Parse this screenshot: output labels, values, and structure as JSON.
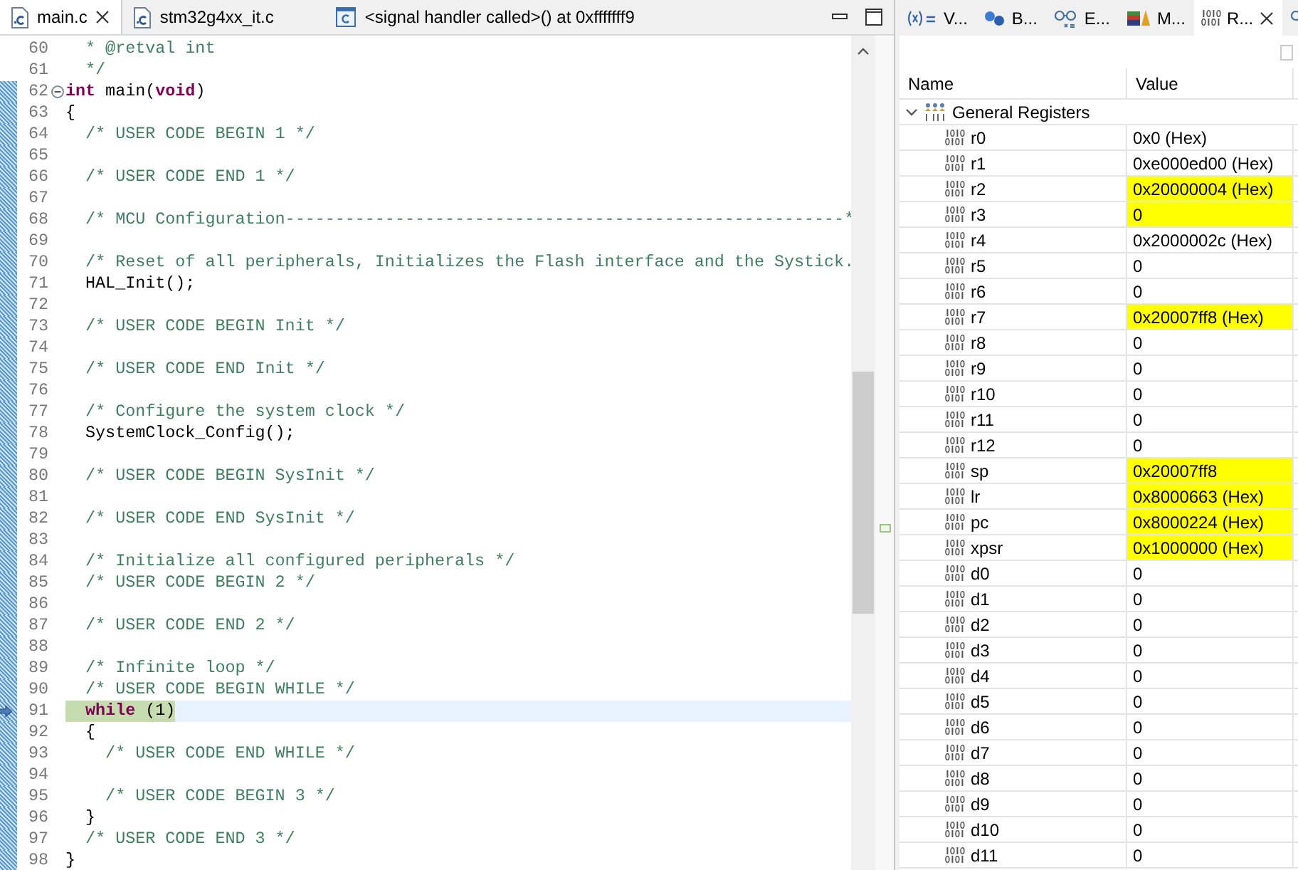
{
  "editor": {
    "tabs": [
      {
        "label": "main.c",
        "kind": "file",
        "selected": true,
        "closable": true
      },
      {
        "label": "stm32g4xx_it.c",
        "kind": "file",
        "selected": false,
        "closable": false
      },
      {
        "label": "<signal handler called>() at 0xfffffff9",
        "kind": "frame",
        "selected": false,
        "closable": false
      }
    ],
    "lines": [
      {
        "number": "60",
        "scope": false,
        "segments": [
          {
            "text": "  * @retval int",
            "kind": "comment"
          }
        ]
      },
      {
        "number": "61",
        "scope": false,
        "segments": [
          {
            "text": "  */",
            "kind": "comment"
          }
        ]
      },
      {
        "number": "62",
        "scope": true,
        "fold": true,
        "segments": [
          {
            "text": "int",
            "kind": "keyword"
          },
          {
            "text": " main(",
            "kind": "plain"
          },
          {
            "text": "void",
            "kind": "keyword"
          },
          {
            "text": ")",
            "kind": "plain"
          }
        ]
      },
      {
        "number": "63",
        "scope": true,
        "segments": [
          {
            "text": "{",
            "kind": "plain"
          }
        ]
      },
      {
        "number": "64",
        "scope": true,
        "segments": [
          {
            "text": "  /* USER CODE BEGIN 1 */",
            "kind": "comment"
          }
        ]
      },
      {
        "number": "65",
        "scope": true
      },
      {
        "number": "66",
        "scope": true,
        "segments": [
          {
            "text": "  /* USER CODE END 1 */",
            "kind": "comment"
          }
        ]
      },
      {
        "number": "67",
        "scope": true
      },
      {
        "number": "68",
        "scope": true,
        "segments": [
          {
            "text": "  /* MCU Configuration--------------------------------------------------------*",
            "kind": "comment"
          }
        ]
      },
      {
        "number": "69",
        "scope": true
      },
      {
        "number": "70",
        "scope": true,
        "segments": [
          {
            "text": "  /* Reset of all peripherals, Initializes the Flash interface and the Systick.",
            "kind": "comment"
          }
        ]
      },
      {
        "number": "71",
        "scope": true,
        "segments": [
          {
            "text": "  HAL_Init();",
            "kind": "plain"
          }
        ]
      },
      {
        "number": "72",
        "scope": true
      },
      {
        "number": "73",
        "scope": true,
        "segments": [
          {
            "text": "  /* USER CODE BEGIN Init */",
            "kind": "comment"
          }
        ]
      },
      {
        "number": "74",
        "scope": true
      },
      {
        "number": "75",
        "scope": true,
        "segments": [
          {
            "text": "  /* USER CODE END Init */",
            "kind": "comment"
          }
        ]
      },
      {
        "number": "76",
        "scope": true
      },
      {
        "number": "77",
        "scope": true,
        "segments": [
          {
            "text": "  /* Configure the system clock */",
            "kind": "comment"
          }
        ]
      },
      {
        "number": "78",
        "scope": true,
        "segments": [
          {
            "text": "  SystemClock_Config();",
            "kind": "plain"
          }
        ]
      },
      {
        "number": "79",
        "scope": true
      },
      {
        "number": "80",
        "scope": true,
        "segments": [
          {
            "text": "  /* USER CODE BEGIN SysInit */",
            "kind": "comment"
          }
        ]
      },
      {
        "number": "81",
        "scope": true
      },
      {
        "number": "82",
        "scope": true,
        "segments": [
          {
            "text": "  /* USER CODE END SysInit */",
            "kind": "comment"
          }
        ]
      },
      {
        "number": "83",
        "scope": true
      },
      {
        "number": "84",
        "scope": true,
        "segments": [
          {
            "text": "  /* Initialize all configured peripherals */",
            "kind": "comment"
          }
        ]
      },
      {
        "number": "85",
        "scope": true,
        "segments": [
          {
            "text": "  /* USER CODE BEGIN 2 */",
            "kind": "comment"
          }
        ]
      },
      {
        "number": "86",
        "scope": true
      },
      {
        "number": "87",
        "scope": true,
        "segments": [
          {
            "text": "  /* USER CODE END 2 */",
            "kind": "comment"
          }
        ]
      },
      {
        "number": "88",
        "scope": true
      },
      {
        "number": "89",
        "scope": true,
        "segments": [
          {
            "text": "  /* Infinite loop */",
            "kind": "comment"
          }
        ]
      },
      {
        "number": "90",
        "scope": true,
        "segments": [
          {
            "text": "  /* USER CODE BEGIN WHILE */",
            "kind": "comment"
          }
        ]
      },
      {
        "number": "91",
        "scope": true,
        "current": true,
        "segments": [
          {
            "text": "  while",
            "kind": "keyword"
          },
          {
            "text": " (1)",
            "kind": "plain"
          }
        ]
      },
      {
        "number": "92",
        "scope": true,
        "segments": [
          {
            "text": "  {",
            "kind": "plain"
          }
        ]
      },
      {
        "number": "93",
        "scope": true,
        "segments": [
          {
            "text": "    /* USER CODE END WHILE */",
            "kind": "comment"
          }
        ]
      },
      {
        "number": "94",
        "scope": true
      },
      {
        "number": "95",
        "scope": true,
        "segments": [
          {
            "text": "    /* USER CODE BEGIN 3 */",
            "kind": "comment"
          }
        ]
      },
      {
        "number": "96",
        "scope": true,
        "segments": [
          {
            "text": "  }",
            "kind": "plain"
          }
        ]
      },
      {
        "number": "97",
        "scope": true,
        "segments": [
          {
            "text": "  /* USER CODE END 3 */",
            "kind": "comment"
          }
        ]
      },
      {
        "number": "98",
        "scope": true,
        "segments": [
          {
            "text": "}",
            "kind": "plain"
          }
        ]
      }
    ]
  },
  "registers_view": {
    "tabs": [
      {
        "label": "V...",
        "kind": "variables",
        "selected": false
      },
      {
        "label": "B...",
        "kind": "breakpoints",
        "selected": false
      },
      {
        "label": "E...",
        "kind": "expressions",
        "selected": false
      },
      {
        "label": "M...",
        "kind": "modules",
        "selected": false
      },
      {
        "label": "R...",
        "kind": "registers",
        "selected": true
      },
      {
        "kind": "expressions",
        "selected": false
      }
    ],
    "columns": [
      "Name",
      "Value"
    ],
    "group": {
      "label": "General Registers",
      "expanded": true,
      "children": [
        {
          "name": "r0",
          "value": "0x0 (Hex)",
          "changed": false
        },
        {
          "name": "r1",
          "value": "0xe000ed00 (Hex)",
          "changed": false
        },
        {
          "name": "r2",
          "value": "0x20000004 (Hex)",
          "changed": true
        },
        {
          "name": "r3",
          "value": "0",
          "changed": true
        },
        {
          "name": "r4",
          "value": "0x2000002c (Hex)",
          "changed": false
        },
        {
          "name": "r5",
          "value": "0",
          "changed": false
        },
        {
          "name": "r6",
          "value": "0",
          "changed": false
        },
        {
          "name": "r7",
          "value": "0x20007ff8 (Hex)",
          "changed": true
        },
        {
          "name": "r8",
          "value": "0",
          "changed": false
        },
        {
          "name": "r9",
          "value": "0",
          "changed": false
        },
        {
          "name": "r10",
          "value": "0",
          "changed": false
        },
        {
          "name": "r11",
          "value": "0",
          "changed": false
        },
        {
          "name": "r12",
          "value": "0",
          "changed": false
        },
        {
          "name": "sp",
          "value": "0x20007ff8",
          "changed": true
        },
        {
          "name": "lr",
          "value": "0x8000663 (Hex)",
          "changed": true
        },
        {
          "name": "pc",
          "value": "0x8000224 (Hex)",
          "changed": true
        },
        {
          "name": "xpsr",
          "value": "0x1000000 (Hex)",
          "changed": true
        },
        {
          "name": "d0",
          "value": "0",
          "changed": false
        },
        {
          "name": "d1",
          "value": "0",
          "changed": false
        },
        {
          "name": "d2",
          "value": "0",
          "changed": false
        },
        {
          "name": "d3",
          "value": "0",
          "changed": false
        },
        {
          "name": "d4",
          "value": "0",
          "changed": false
        },
        {
          "name": "d5",
          "value": "0",
          "changed": false
        },
        {
          "name": "d6",
          "value": "0",
          "changed": false
        },
        {
          "name": "d7",
          "value": "0",
          "changed": false
        },
        {
          "name": "d8",
          "value": "0",
          "changed": false
        },
        {
          "name": "d9",
          "value": "0",
          "changed": false
        },
        {
          "name": "d10",
          "value": "0",
          "changed": false
        },
        {
          "name": "d11",
          "value": "0",
          "changed": false
        }
      ]
    }
  }
}
